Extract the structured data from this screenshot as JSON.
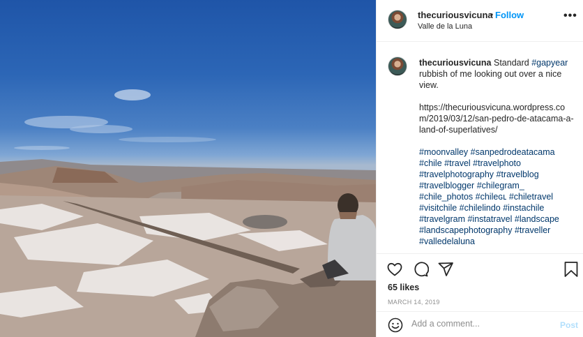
{
  "post": {
    "username": "thecuriousvicuna",
    "follow_label": "Follow",
    "separator": "•",
    "location": "Valle de la Luna",
    "more_label": "•••",
    "caption": {
      "username": "thecuriousvicuna",
      "text_before_tag": "Standard ",
      "first_tag": "#gapyear",
      "text_after_tag": " rubbish of me looking out over a nice view.",
      "url": "https://thecuriousvicuna.wordpress.com/2019/03/12/san-pedro-de-atacama-a-land-of-superlatives/",
      "hashtags": [
        "#moonvalley",
        "#sanpedrodeatacama",
        "#chile",
        "#travel",
        "#travelphoto",
        "#travelphotography",
        "#travelblog",
        "#travelblogger",
        "#chilegram_",
        "#chile_photos",
        "#chileɢʟ",
        "#chiletravel",
        "#visitchile",
        "#chilelindo",
        "#instachile",
        "#travelgram",
        "#instatravel",
        "#landscape",
        "#landscapephotography",
        "#traveller",
        "#valledelaluna"
      ]
    },
    "likes": "65 likes",
    "date": "MARCH 14, 2019"
  },
  "comment": {
    "placeholder": "Add a comment...",
    "post_label": "Post"
  },
  "icons": {
    "like": "heart-icon",
    "comment": "comment-icon",
    "share": "paper-plane-icon",
    "save": "bookmark-icon",
    "emoji": "emoji-icon",
    "more": "more-icon"
  },
  "colors": {
    "link": "#0095f6",
    "hashtag": "#00376b",
    "muted": "#8e8e8e",
    "post_disabled": "#b2dffc"
  }
}
